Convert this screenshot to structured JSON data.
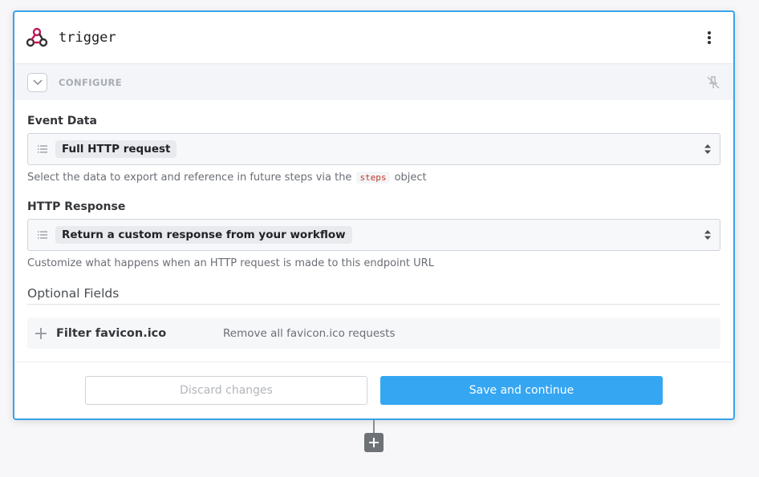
{
  "header": {
    "title": "trigger",
    "logo_icon": "webhook-icon",
    "menu_icon": "kebab-menu-icon"
  },
  "configure": {
    "label": "CONFIGURE",
    "collapse_icon": "chevron-down-icon",
    "pin_icon": "pin-off-icon"
  },
  "fields": [
    {
      "label": "Event Data",
      "value": "Full HTTP request",
      "help_before": "Select the data to export and reference in future steps via the",
      "help_code": "steps",
      "help_after": "object"
    },
    {
      "label": "HTTP Response",
      "value": "Return a custom response from your workflow",
      "help": "Customize what happens when an HTTP request is made to this endpoint URL"
    }
  ],
  "optional": {
    "heading": "Optional Fields",
    "items": [
      {
        "name": "Filter favicon.ico",
        "description": "Remove all favicon.ico requests"
      }
    ]
  },
  "footer": {
    "discard_label": "Discard changes",
    "save_label": "Save and continue"
  },
  "colors": {
    "accent": "#35a6f2",
    "card_border": "#3aa3e8",
    "logo": "#c2185b",
    "code_text": "#c0392b"
  }
}
